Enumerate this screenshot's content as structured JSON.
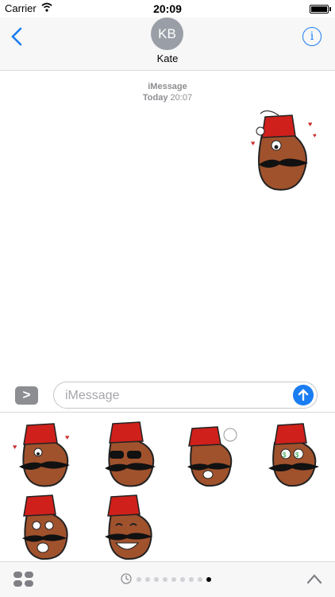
{
  "status": {
    "carrier": "Carrier",
    "time": "20:09"
  },
  "header": {
    "avatar_initials": "KB",
    "contact_name": "Kate",
    "info_label": "i"
  },
  "thread": {
    "service": "iMessage",
    "day": "Today",
    "time": "20:07"
  },
  "composer": {
    "expand_label": ">",
    "placeholder": "iMessage"
  },
  "stickers": [
    {
      "name": "fez-hearts"
    },
    {
      "name": "fez-sunglasses"
    },
    {
      "name": "fez-steam"
    },
    {
      "name": "fez-money"
    },
    {
      "name": "fez-angry"
    },
    {
      "name": "fez-laughing"
    }
  ],
  "pager": {
    "count": 9,
    "active_index": 8
  },
  "colors": {
    "accent": "#1a7df2",
    "fez": "#d0201b",
    "bean": "#a0522d"
  }
}
